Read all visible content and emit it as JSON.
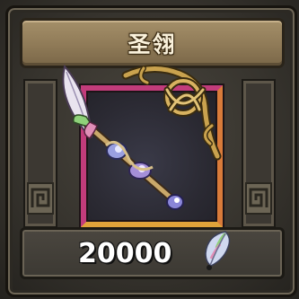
{
  "item": {
    "name": "圣翎",
    "price": "20000"
  },
  "icons": {
    "weapon": "feathered-staff-icon",
    "currency": "feather-currency-icon",
    "corner_ornament": "celtic-knot-icon",
    "side_ornament": "meander-pattern-icon"
  },
  "colors": {
    "title_text": "#fbf2dc",
    "frame_pink": "#c23c7b",
    "frame_orange": "#e0a33a",
    "price_text": "#ffffff"
  }
}
